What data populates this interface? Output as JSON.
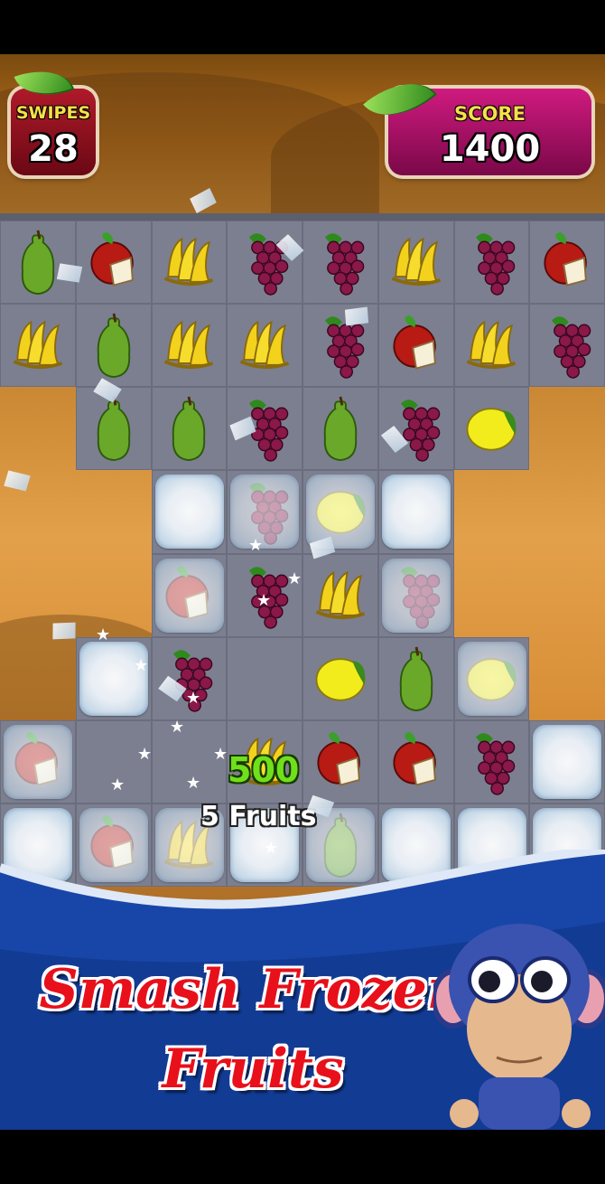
{
  "hud": {
    "swipes_label": "SWIPES",
    "swipes_value": "28",
    "score_label": "SCORE",
    "score_value": "1400"
  },
  "board": {
    "rows": [
      [
        "pear",
        "apple",
        "banana",
        "grapes",
        "grapes",
        "banana",
        "grapes",
        "apple"
      ],
      [
        "banana",
        "pear",
        "banana",
        "banana",
        "grapes",
        "apple",
        "banana",
        "grapes"
      ],
      [
        null,
        "pear",
        "pear",
        "grapes",
        "pear",
        "grapes",
        "lemon",
        null
      ],
      [
        null,
        null,
        "ice",
        "grapes",
        "lemon",
        "ice",
        null,
        null
      ],
      [
        null,
        null,
        "apple",
        "grapes",
        "banana",
        "grapes",
        null,
        null
      ],
      [
        null,
        "ice",
        "grapes",
        "empty",
        "lemon",
        "pear",
        "lemon",
        null
      ],
      [
        "apple",
        "empty",
        "empty",
        "banana",
        "apple",
        "apple",
        "grapes",
        "ice"
      ],
      [
        "ice",
        "apple",
        "banana",
        "ice",
        "pear",
        "ice",
        "ice",
        "ice"
      ]
    ],
    "frozen": [
      [
        3,
        2
      ],
      [
        3,
        3
      ],
      [
        3,
        4
      ],
      [
        3,
        5
      ],
      [
        4,
        2
      ],
      [
        4,
        5
      ],
      [
        5,
        1
      ],
      [
        5,
        6
      ],
      [
        6,
        0
      ],
      [
        6,
        7
      ],
      [
        7,
        0
      ],
      [
        7,
        1
      ],
      [
        7,
        2
      ],
      [
        7,
        3
      ],
      [
        7,
        4
      ],
      [
        7,
        5
      ],
      [
        7,
        6
      ],
      [
        7,
        7
      ]
    ]
  },
  "combo": {
    "points": "500",
    "label": "5 Fruits"
  },
  "promo": {
    "line1": "Smash  Frozen",
    "line2": "Fruits"
  },
  "colors": {
    "swipes_bg": "#8c1020",
    "score_bg": "#b8106a",
    "label_yellow": "#f4e04a",
    "promo_red": "#e8101a",
    "wave_blue": "#1846a8"
  },
  "icons": [
    "leaf-icon",
    "pear-icon",
    "apple-icon",
    "banana-icon",
    "grapes-icon",
    "lemon-icon",
    "monkey-mascot"
  ]
}
